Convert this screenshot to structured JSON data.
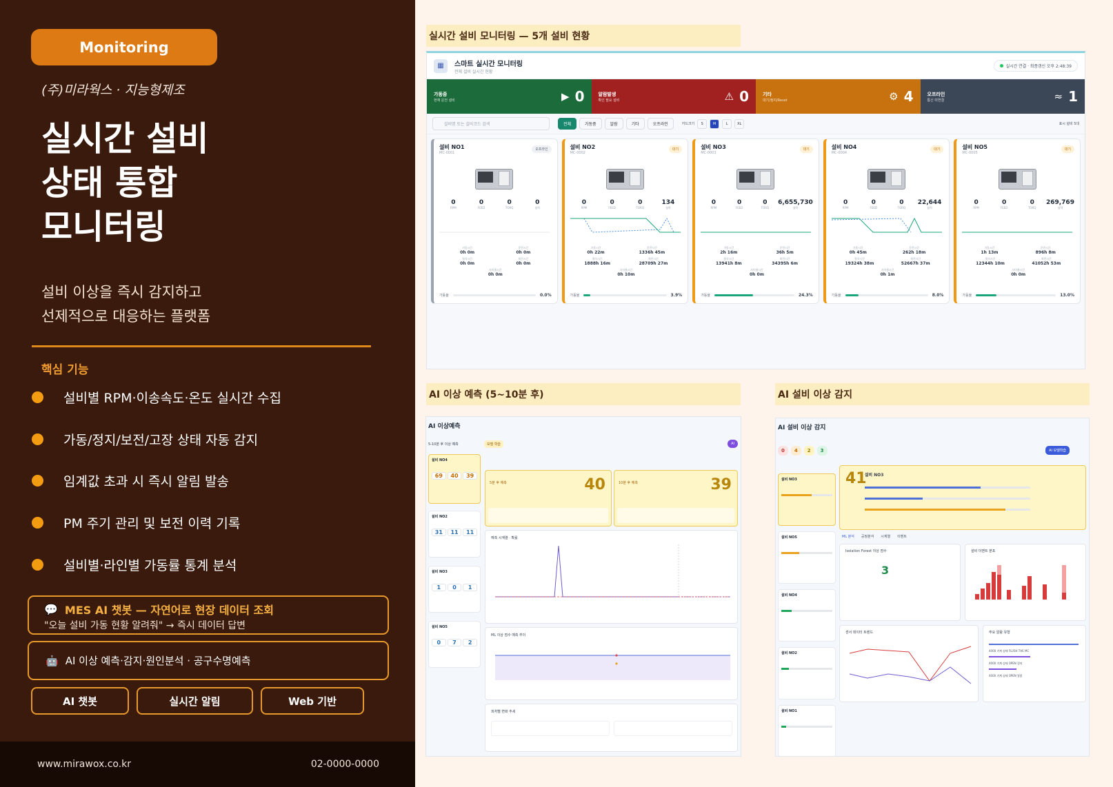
{
  "left": {
    "badge": "Monitoring",
    "company": "(주)미라웍스 · 지능형제조",
    "headline": [
      "실시간 설비",
      "상태 통합",
      "모니터링"
    ],
    "subtitle": [
      "설비 이상을 즉시 감지하고",
      "선제적으로 대응하는 플랫폼"
    ],
    "section_title": "핵심 기능",
    "features": [
      "설비별 RPM·이송속도·온도 실시간 수집",
      "가동/정지/보전/고장 상태 자동 감지",
      "임계값 초과 시 즉시 알림 발송",
      "PM 주기 관리 및 보전 이력 기록",
      "설비별·라인별 가동률 통계 분석"
    ],
    "chatbot_box": {
      "icon": "chat-bubble-icon",
      "title": "MES AI 챗봇 — 자연어로 현장 데이터 조회",
      "desc": "\"오늘 설비 가동 현황 알려줘\" → 즉시 데이터 답변"
    },
    "ai_box": {
      "icon": "robot-icon",
      "text": "AI 이상 예측·감지·원인분석 · 공구수명예측"
    },
    "chips": [
      "AI 챗봇",
      "실시간 알림",
      "Web 기반"
    ],
    "footer": {
      "url": "www.mirawox.co.kr",
      "phone": "02-0000-0000"
    }
  },
  "captions": {
    "top": "실시간 설비 모니터링 — 5개 설비 현황",
    "predict": "AI 이상 예측 (5~10분 후)",
    "detect": "AI 설비 이상 감지"
  },
  "monitor": {
    "title": "스마트 실시간 모니터링",
    "subtitle": "전체 설비 실시간 현황",
    "connection": "실시간 연결 · 최종갱신 오후 2:48:39",
    "stats": [
      {
        "label": "가동중",
        "sub": "현재 운전 설비",
        "icon": "play-icon",
        "glyph": "▶",
        "value": "0",
        "color": "#1c6b3a"
      },
      {
        "label": "알람발생",
        "sub": "확인 필요 설비",
        "icon": "warning-icon",
        "glyph": "⚠",
        "value": "0",
        "color": "#a12121"
      },
      {
        "label": "기타",
        "sub": "대기/정지/Reset",
        "icon": "gear-icon",
        "glyph": "⚙",
        "value": "4",
        "color": "#c7720f"
      },
      {
        "label": "오프라인",
        "sub": "통신 미연결",
        "icon": "wifi-off-icon",
        "glyph": "≈",
        "value": "1",
        "color": "#3b4657"
      }
    ],
    "search_placeholder": "설비명 또는 설비코드 검색",
    "filters": [
      "전체",
      "가동중",
      "알람",
      "기타",
      "오프라인"
    ],
    "card_size_label": "카드크기",
    "sizes": [
      "S",
      "M",
      "L",
      "XL"
    ],
    "display_label": "표시 설비 5대",
    "metric_labels": [
      "RPM",
      "FEED",
      "TORQ",
      "실적"
    ],
    "time_labels": [
      "가동시간",
      "운전시간",
      "절삭시간",
      "최전시간",
      "사이클시간"
    ],
    "util_label": "가동율",
    "cards": [
      {
        "name": "설비 NO1",
        "code": "MC-0001",
        "status": "오프라인",
        "metrics": [
          "0",
          "0",
          "0",
          "0"
        ],
        "times": [
          "0h 0m",
          "0h 0m",
          "0h 0m",
          "0h 0m",
          "0h 0m"
        ],
        "util": "0.0%",
        "util_value": 0.0
      },
      {
        "name": "설비 NO2",
        "code": "MC-0002",
        "status": "대기",
        "metrics": [
          "0",
          "0",
          "0",
          "134"
        ],
        "times": [
          "0h 22m",
          "1336h 45m",
          "1888h 16m",
          "28709h 27m",
          "0h 10m"
        ],
        "util": "3.9%",
        "util_value": 3.9
      },
      {
        "name": "설비 NO3",
        "code": "MC-0003",
        "status": "대기",
        "metrics": [
          "0",
          "0",
          "0",
          "6,655,730"
        ],
        "times": [
          "2h 16m",
          "36h 5m",
          "13941h 8m",
          "34395h 6m",
          "0h 0m"
        ],
        "util": "24.3%",
        "util_value": 24.3
      },
      {
        "name": "설비 NO4",
        "code": "MC-0004",
        "status": "대기",
        "metrics": [
          "0",
          "0",
          "0",
          "22,644"
        ],
        "times": [
          "0h 45m",
          "262h 18m",
          "19324h 38m",
          "52667h 37m",
          "0h 1m"
        ],
        "util": "8.0%",
        "util_value": 8.0
      },
      {
        "name": "설비 NO5",
        "code": "MC-0005",
        "status": "대기",
        "metrics": [
          "0",
          "0",
          "0",
          "269,769"
        ],
        "times": [
          "1h 13m",
          "896h 8m",
          "12344h 10m",
          "41052h 53m",
          "0h 0m"
        ],
        "util": "13.0%",
        "util_value": 13.0
      }
    ]
  },
  "predict": {
    "title": "AI 이상예측",
    "tab": "5-10분 후 이상 예측",
    "badge": "모델 학습",
    "mini": [
      {
        "name": "설비 NO4",
        "values": [
          "69",
          "40",
          "39"
        ]
      },
      {
        "name": "설비 NO2",
        "values": [
          "31",
          "11",
          "11"
        ]
      },
      {
        "name": "설비 NO3",
        "values": [
          "1",
          "0",
          "1"
        ]
      },
      {
        "name": "설비 NO5",
        "values": [
          "0",
          "7",
          "2"
        ]
      }
    ],
    "big": [
      {
        "label": "5분 후 예측",
        "value": "40"
      },
      {
        "label": "10분 후 예측",
        "value": "39"
      }
    ],
    "chart1_title": "예측 시계열 · 확률",
    "chart2_title": "ML 이상 점수 예측 추이",
    "table_title": "피처별 변화 추세"
  },
  "detect": {
    "title": "AI 설비 이상 감지",
    "chips": [
      "0",
      "4",
      "2",
      "3"
    ],
    "score": "41",
    "machine": "설비 NO3",
    "model_btn": "AI 모델학습",
    "iso_score": "3",
    "tabs": [
      "ML 분석",
      "공정분석",
      "시계열",
      "이벤트"
    ],
    "iso_title": "Isolation Forest 이상 점수",
    "bar_title": "설비 이벤트 분포",
    "trend_title": "센서 데이터 트렌드",
    "list_title": "주요 알람 유형",
    "list": [
      "4000 기계 상태 FLUSH THE MC",
      "4000 기계 상태 OPEN 정지",
      "4000 기계 상태 OPEN 알람"
    ],
    "sidebar": [
      "설비 NO3",
      "설비 NO5",
      "설비 NO4",
      "설비 NO2",
      "설비 NO1"
    ]
  }
}
